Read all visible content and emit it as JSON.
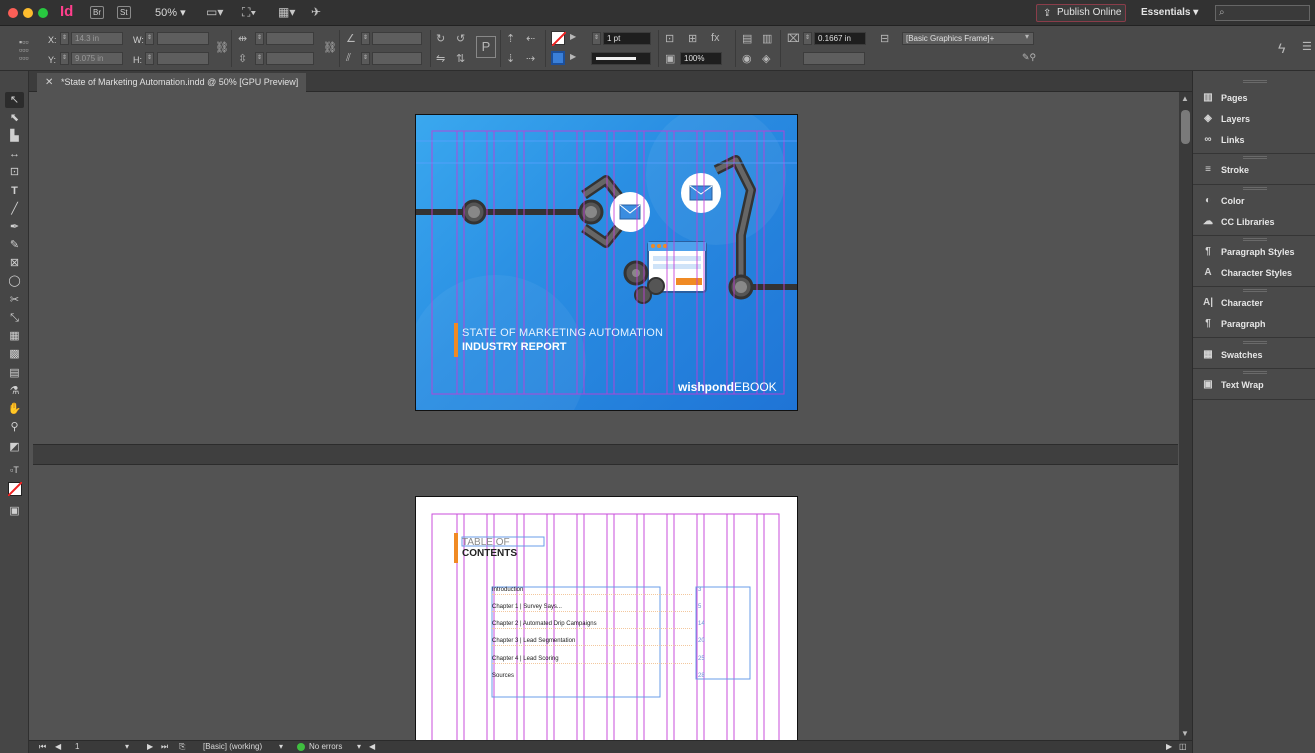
{
  "app": {
    "logo": "Id",
    "bridge_label": "Br",
    "stock_label": "St",
    "zoom": "50%",
    "publish_label": "Publish Online",
    "workspace": "Essentials",
    "search_placeholder": "⌕"
  },
  "control": {
    "x_label": "X:",
    "x_value": "14.3 in",
    "y_label": "Y:",
    "y_value": "9.075 in",
    "w_label": "W:",
    "w_value": "",
    "h_label": "H:",
    "h_value": "",
    "stroke_weight": "1 pt",
    "opacity": "100%",
    "offset_value": "0.1667 in",
    "object_style": "[Basic Graphics Frame]+"
  },
  "document": {
    "tab_title": "*State of Marketing Automation.indd @ 50% [GPU Preview]",
    "cover": {
      "title_line1": "STATE OF MARKETING AUTOMATION",
      "title_line2": "INDUSTRY REPORT",
      "brand_bold": "wishpond",
      "brand_light": "EBOOK"
    },
    "toc": {
      "title_line1": "TABLE OF",
      "title_line2": "CONTENTS",
      "entries": [
        {
          "label": "Introduction",
          "page": "3"
        },
        {
          "label": "Chapter 1 | Survey Says...",
          "page": "5"
        },
        {
          "label": "Chapter 2 | Automated Drip Campaigns",
          "page": "14"
        },
        {
          "label": "Chapter 3 | Lead Segmentation",
          "page": "20"
        },
        {
          "label": "Chapter 4 | Lead Scoring",
          "page": "25"
        },
        {
          "label": "Sources",
          "page": "28"
        }
      ]
    }
  },
  "panels": [
    {
      "label": "Pages",
      "icon": "pages-icon"
    },
    {
      "label": "Layers",
      "icon": "layers-icon"
    },
    {
      "label": "Links",
      "icon": "links-icon"
    },
    {
      "label": "Stroke",
      "icon": "stroke-icon"
    },
    {
      "label": "Color",
      "icon": "color-icon"
    },
    {
      "label": "CC Libraries",
      "icon": "cc-libraries-icon"
    },
    {
      "label": "Paragraph Styles",
      "icon": "paragraph-styles-icon"
    },
    {
      "label": "Character Styles",
      "icon": "character-styles-icon"
    },
    {
      "label": "Character",
      "icon": "character-icon"
    },
    {
      "label": "Paragraph",
      "icon": "paragraph-icon"
    },
    {
      "label": "Swatches",
      "icon": "swatches-icon"
    },
    {
      "label": "Text Wrap",
      "icon": "text-wrap-icon"
    }
  ],
  "status": {
    "page_number": "1",
    "preflight_profile": "[Basic] (working)",
    "errors": "No errors"
  },
  "colors": {
    "accent_orange": "#f08a24",
    "cover_blue": "#2a8fe3",
    "guide_magenta": "#c43bd8",
    "ok_green": "#3fbf3f"
  }
}
